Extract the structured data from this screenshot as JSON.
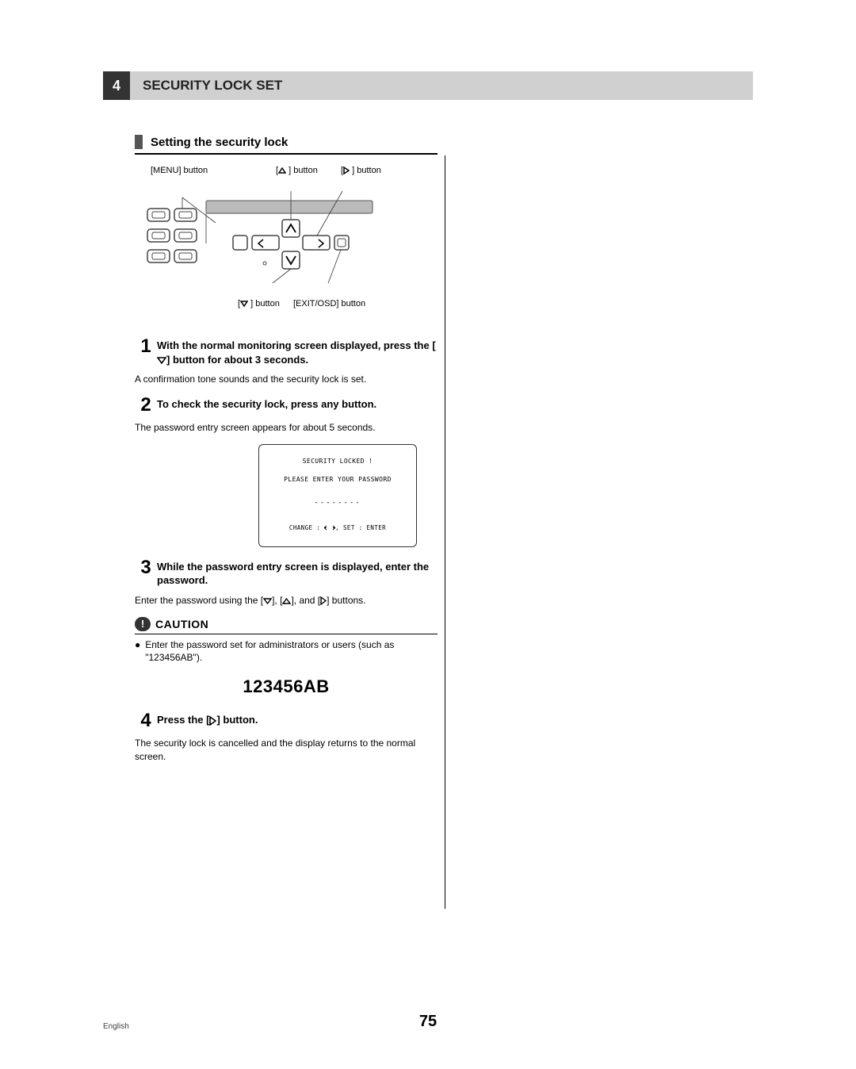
{
  "chapter": {
    "number": "4",
    "title": "SECURITY LOCK SET"
  },
  "section_title": "Setting the security lock",
  "diagram_labels": {
    "menu": "[MENU] button",
    "up_button": "] button",
    "right_button": "] button",
    "down_button": "] button",
    "exit_osd": "[EXIT/OSD] button"
  },
  "steps": [
    {
      "num": "1",
      "text_before": "With the normal monitoring screen displayed, press the [",
      "text_after": "] button for about 3 seconds.",
      "body": "A confirmation tone sounds and the security lock is set."
    },
    {
      "num": "2",
      "text": "To check the security lock, press any button.",
      "body": "The password entry screen appears for about 5 seconds."
    },
    {
      "num": "3",
      "text": "While the password entry screen is displayed, enter the password.",
      "body_before": "Enter the password using the [",
      "body_mid1": "], [",
      "body_mid2": "], and [",
      "body_after": "] buttons."
    },
    {
      "num": "4",
      "text_before": "Press the [",
      "text_after": "] button.",
      "body": "The security lock is cancelled and the display returns to the normal screen."
    }
  ],
  "screen": {
    "line1": "SECURITY LOCKED !",
    "line2": "PLEASE ENTER YOUR PASSWORD",
    "line3": "--------",
    "line4_before": "CHANGE : ",
    "line4_after": ",   SET : ENTER"
  },
  "caution": {
    "title": "CAUTION",
    "bullet": "Enter the password set for administrators or users (such as \"123456AB\")."
  },
  "password_example": "123456AB",
  "footer": {
    "language": "English",
    "page_number": "75"
  }
}
